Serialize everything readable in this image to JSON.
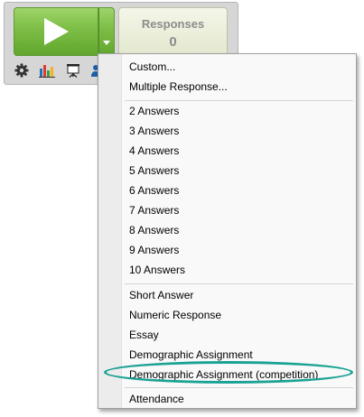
{
  "toolbar": {
    "responses_label": "Responses",
    "responses_count": "0",
    "icons": [
      "gear-icon",
      "bar-chart-icon",
      "presentation-icon",
      "participant-icon"
    ],
    "accent_green": "#7cbd45"
  },
  "menu": {
    "group1": [
      "Custom...",
      "Multiple Response..."
    ],
    "group2": [
      "2 Answers",
      "3 Answers",
      "4 Answers",
      "5 Answers",
      "6 Answers",
      "7 Answers",
      "8 Answers",
      "9 Answers",
      "10 Answers"
    ],
    "group3": [
      "Short Answer",
      "Numeric Response",
      "Essay",
      "Demographic Assignment",
      "Demographic Assignment (competition)"
    ],
    "group4": [
      "Attendance"
    ],
    "highlighted_item": "Demographic Assignment (competition)",
    "highlight_color": "#1aa294"
  }
}
